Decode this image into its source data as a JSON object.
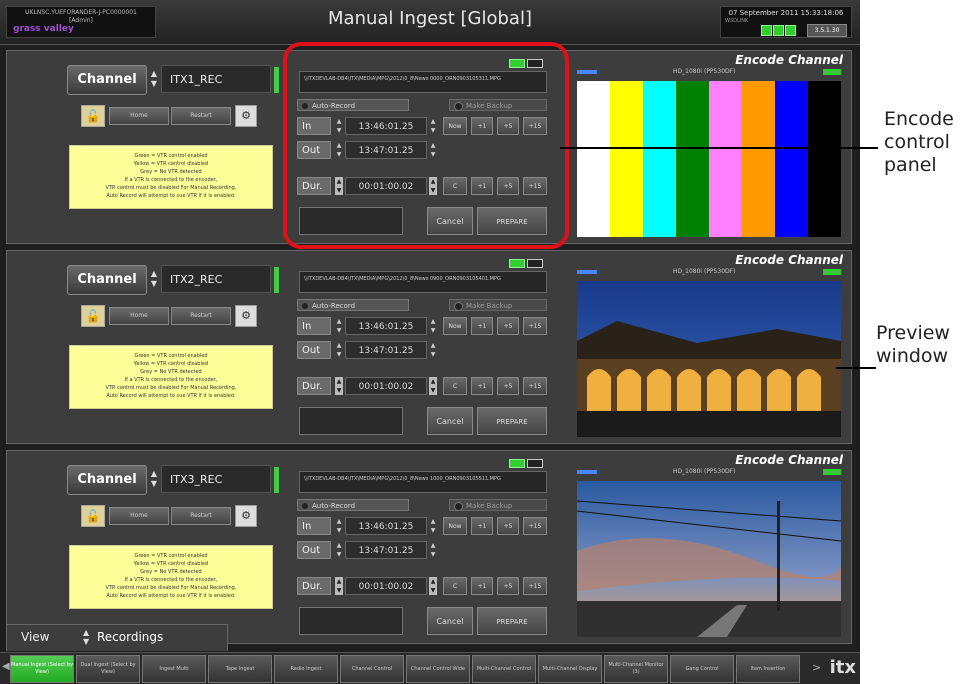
{
  "header": {
    "left_line1": "UKLNSC.YUEFORANDER-J-PC0000001",
    "left_line2": "[Admin]",
    "logo": "grass valley",
    "title": "Manual Ingest [Global]",
    "date": "07 September 2011 15:33:18:06",
    "date_sub": "WSDLINK",
    "clock_label": "3.5.1.30"
  },
  "info_lines": [
    "Green = VTR control enabled",
    "Yellow = VTR control disabled",
    "Grey = No VTR detected",
    "If a VTR is connected to the encoder,",
    "VTR control must be disabled For Manual Recording.",
    "Auto Record will attempt to cue VTR if it is enabled."
  ],
  "common": {
    "channel_label": "Channel",
    "btn1": "Home",
    "btn2": "Restart",
    "auto_record": "Auto-Record",
    "make_backup": "Make Backup",
    "in_label": "In",
    "out_label": "Out",
    "dur_label": "Dur.",
    "in_value": "13:46:01.25",
    "out_value": "13:47:01.25",
    "dur_value": "00:01:00.02",
    "now_label": "Now",
    "c_label": "C",
    "plus1": "+1",
    "plus5": "+5",
    "plus15": "+15",
    "cancel": "Cancel",
    "prepare": "PREPARE",
    "encode_channel": "Encode Channel",
    "resolution": "HD_1080i (PP530DF)"
  },
  "channels": [
    {
      "name": "ITX1_REC",
      "filepath": "\\\\ITXDEVLAB-DB4\\ITX\\MEDIA\\MPG\\2012\\0_8\\News 0000_ORN0903105311.MPG",
      "preview": "color-bars"
    },
    {
      "name": "ITX2_REC",
      "filepath": "\\\\ITXDEVLAB-DB4\\ITX\\MEDIA\\MPG\\2012\\0_8\\News 0900_ORN0903105401.MPG",
      "preview": "station-photo"
    },
    {
      "name": "ITX3_REC",
      "filepath": "\\\\ITXDEVLAB-DB4\\ITX\\MEDIA\\MPG\\2012\\0_8\\News 1000_ORN0903105511.MPG",
      "preview": "sky-photo"
    }
  ],
  "view": {
    "label": "View",
    "value": "Recordings"
  },
  "nav_tabs": [
    {
      "label": "Manual Ingest (Select by View)",
      "active": true
    },
    {
      "label": "Dual Ingest (Select by View)",
      "active": false
    },
    {
      "label": "Ingest Multi",
      "active": false
    },
    {
      "label": "Tape Ingest",
      "active": false
    },
    {
      "label": "Radio Ingest",
      "active": false
    },
    {
      "label": "Channel Control",
      "active": false
    },
    {
      "label": "Channel Control Wide",
      "active": false
    },
    {
      "label": "Multi-Channel Control",
      "active": false
    },
    {
      "label": "Multi-Channel Display",
      "active": false
    },
    {
      "label": "Multi-Channel Monitor (3)",
      "active": false
    },
    {
      "label": "Gang Control",
      "active": false
    },
    {
      "label": "Item Insertion",
      "active": false
    }
  ],
  "nav_logo": "itx",
  "callouts": {
    "encode_control": "Encode control panel",
    "encode_control_lines": [
      "Encode",
      "control",
      "panel"
    ],
    "preview": "Preview window",
    "preview_lines": [
      "Preview",
      "window"
    ]
  },
  "colors": {
    "highlight": "#e0101a",
    "active_nav": "#33aa33",
    "info_bg": "#ffff99",
    "color_bars": [
      "#ffffff",
      "#ffff00",
      "#00ffff",
      "#008000",
      "#ff80ff",
      "#ff9900",
      "#0000ff",
      "#000000"
    ]
  }
}
